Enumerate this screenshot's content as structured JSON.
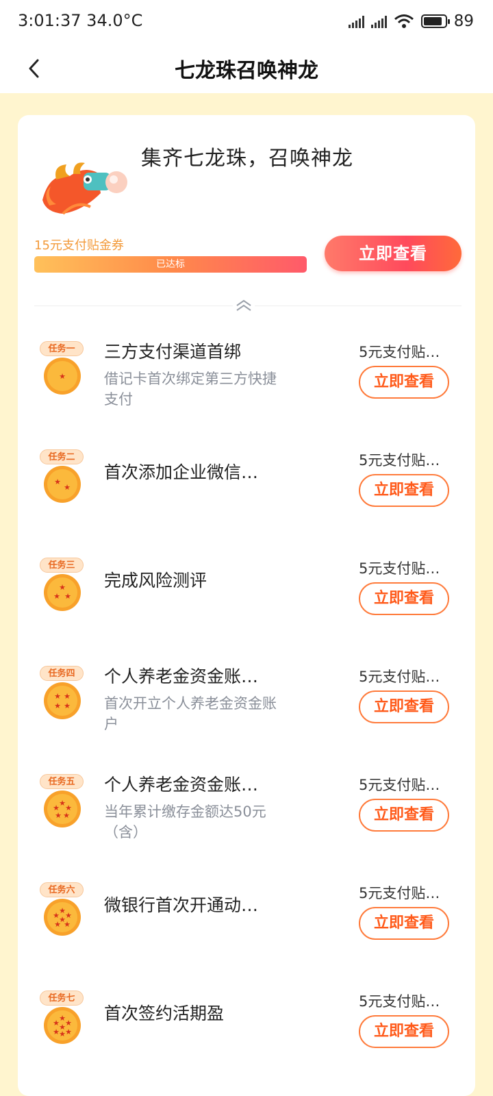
{
  "status": {
    "time": "3:01:37",
    "temp": "34.0°C",
    "battery": "89"
  },
  "nav": {
    "back_icon": "chevron-left-icon",
    "title": "七龙珠召唤神龙"
  },
  "hero": {
    "title": "集齐七龙珠，召唤神龙",
    "progress_label": "15元支付贴金券",
    "progress_text": "已达标",
    "progress": 1.0,
    "button": "立即查看"
  },
  "tasks": [
    {
      "tag": "任务一",
      "stars": 1,
      "title": "三方支付渠道首绑",
      "desc": "借记卡首次绑定第三方快捷支付",
      "reward": "5元支付贴…",
      "button": "立即查看"
    },
    {
      "tag": "任务二",
      "stars": 2,
      "title": "首次添加企业微信…",
      "desc": "",
      "reward": "5元支付贴…",
      "button": "立即查看"
    },
    {
      "tag": "任务三",
      "stars": 3,
      "title": "完成风险测评",
      "desc": "",
      "reward": "5元支付贴…",
      "button": "立即查看"
    },
    {
      "tag": "任务四",
      "stars": 4,
      "title": "个人养老金资金账…",
      "desc": "首次开立个人养老金资金账户",
      "reward": "5元支付贴…",
      "button": "立即查看"
    },
    {
      "tag": "任务五",
      "stars": 5,
      "title": "个人养老金资金账…",
      "desc": "当年累计缴存金额达50元（含）",
      "reward": "5元支付贴…",
      "button": "立即查看"
    },
    {
      "tag": "任务六",
      "stars": 6,
      "title": "微银行首次开通动…",
      "desc": "",
      "reward": "5元支付贴…",
      "button": "立即查看"
    },
    {
      "tag": "任务七",
      "stars": 7,
      "title": "首次签约活期盈",
      "desc": "",
      "reward": "5元支付贴…",
      "button": "立即查看"
    }
  ],
  "colors": {
    "accent": "#ff5a1a",
    "tag_bg": "#ffe4c8",
    "page_bg": "#fff5cf"
  }
}
